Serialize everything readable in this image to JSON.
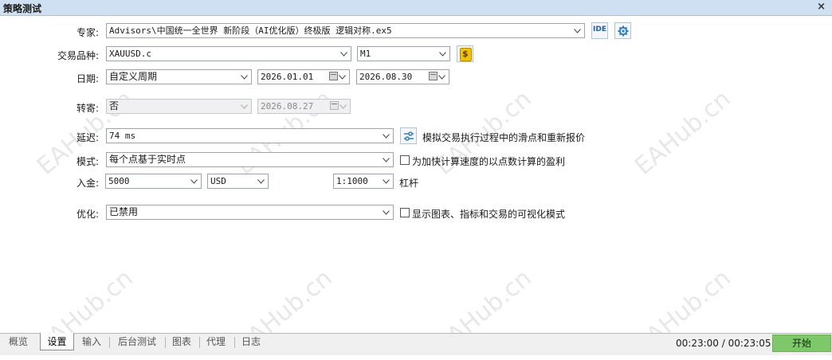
{
  "window": {
    "title": "策略测试",
    "close_glyph": "×"
  },
  "form": {
    "expert": {
      "label": "专家:",
      "value": "Advisors\\中国统一全世界 新阶段（AI优化版）终极版 逻辑对称.ex5",
      "ide_label": "IDE"
    },
    "symbol": {
      "label": "交易品种:",
      "value": "XAUUSD.c",
      "timeframe": "M1",
      "symbol_icon": "$"
    },
    "dates": {
      "label": "日期:",
      "mode": "自定义周期",
      "from": "2026.01.01",
      "to": "2026.08.30"
    },
    "forward": {
      "label": "转寄:",
      "value": "否",
      "date": "2026.08.27"
    },
    "delay": {
      "label": "延迟:",
      "value": "74 ms",
      "description": "模拟交易执行过程中的滑点和重新报价"
    },
    "model": {
      "label": "模式:",
      "value": "每个点基于实时点",
      "checkbox_label": "为加快计算速度的以点数计算的盈利",
      "checked": false
    },
    "deposit": {
      "label": "入金:",
      "amount": "5000",
      "currency": "USD",
      "leverage": "1:1000",
      "leverage_label": "杠杆"
    },
    "optimization": {
      "label": "优化:",
      "value": "已禁用",
      "checkbox_label": "显示图表、指标和交易的可视化模式",
      "checked": false
    }
  },
  "watermark": "EAHub.cn",
  "bottom": {
    "tabs": [
      "概览",
      "设置",
      "输入",
      "后台测试",
      "图表",
      "代理",
      "日志"
    ],
    "active_tab": "设置",
    "timer": "00:23:00 / 00:23:05",
    "start_label": "开始"
  },
  "colors": {
    "titlebar": "#cfe0f2",
    "start_button": "#7fc86a",
    "symbol_icon": "#f2c200",
    "settings_icon": "#2f7fc6"
  }
}
